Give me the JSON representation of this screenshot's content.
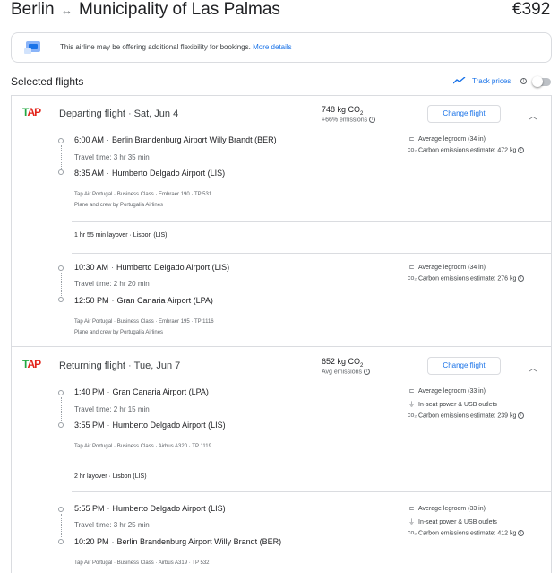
{
  "header": {
    "from": "Berlin",
    "to": "Municipality of Las Palmas",
    "swap_icon": "↔",
    "price": "€392"
  },
  "notice": {
    "text": "This airline may be offering additional flexibility for bookings.",
    "link": "More details"
  },
  "selected": {
    "title": "Selected flights",
    "track_label": "Track prices",
    "track_on": false
  },
  "airline_logo": {
    "g": "T",
    "r": "AP"
  },
  "departing": {
    "title": "Departing flight",
    "date": "Sat, Jun 4",
    "co2": "748 kg CO",
    "co2_sub_2": "2",
    "emissions_note": "+66% emissions",
    "change_label": "Change flight",
    "leg1": {
      "dep_time": "6:00 AM",
      "dep_airport": "Berlin Brandenburg Airport Willy Brandt (BER)",
      "travel_time": "Travel time: 3 hr 35 min",
      "arr_time": "8:35 AM",
      "arr_airport": "Humberto Delgado Airport (LIS)",
      "meta": "Tap Air Portugal · Business Class · Embraer 190 · TP 531",
      "meta2": "Plane and crew by Portugalia Airlines",
      "legroom": "Average legroom (34 in)",
      "carbon": "Carbon emissions estimate: 472 kg"
    },
    "layover": "1 hr 55 min layover · Lisbon (LIS)",
    "leg2": {
      "dep_time": "10:30 AM",
      "dep_airport": "Humberto Delgado Airport (LIS)",
      "travel_time": "Travel time: 2 hr 20 min",
      "arr_time": "12:50 PM",
      "arr_airport": "Gran Canaria Airport (LPA)",
      "meta": "Tap Air Portugal · Business Class · Embraer 195 · TP 1116",
      "meta2": "Plane and crew by Portugalia Airlines",
      "legroom": "Average legroom (34 in)",
      "carbon": "Carbon emissions estimate: 276 kg"
    }
  },
  "returning": {
    "title": "Returning flight",
    "date": "Tue, Jun 7",
    "co2": "652 kg CO",
    "co2_sub_2": "2",
    "emissions_note": "Avg emissions",
    "change_label": "Change flight",
    "leg1": {
      "dep_time": "1:40 PM",
      "dep_airport": "Gran Canaria Airport (LPA)",
      "travel_time": "Travel time: 2 hr 15 min",
      "arr_time": "3:55 PM",
      "arr_airport": "Humberto Delgado Airport (LIS)",
      "meta": "Tap Air Portugal · Business Class · Airbus A320 · TP 1119",
      "legroom": "Average legroom (33 in)",
      "power": "In-seat power & USB outlets",
      "carbon": "Carbon emissions estimate: 239 kg"
    },
    "layover": "2 hr layover · Lisbon (LIS)",
    "leg2": {
      "dep_time": "5:55 PM",
      "dep_airport": "Humberto Delgado Airport (LIS)",
      "travel_time": "Travel time: 3 hr 25 min",
      "arr_time": "10:20 PM",
      "arr_airport": "Berlin Brandenburg Airport Willy Brandt (BER)",
      "meta": "Tap Air Portugal · Business Class · Airbus A319 · TP 532",
      "legroom": "Average legroom (33 in)",
      "power": "In-seat power & USB outlets",
      "carbon": "Carbon emissions estimate: 412 kg"
    }
  },
  "colors": {
    "accent": "#1a73e8",
    "border": "#dadce0",
    "tap_green": "#23a842",
    "tap_red": "#e2231a"
  }
}
